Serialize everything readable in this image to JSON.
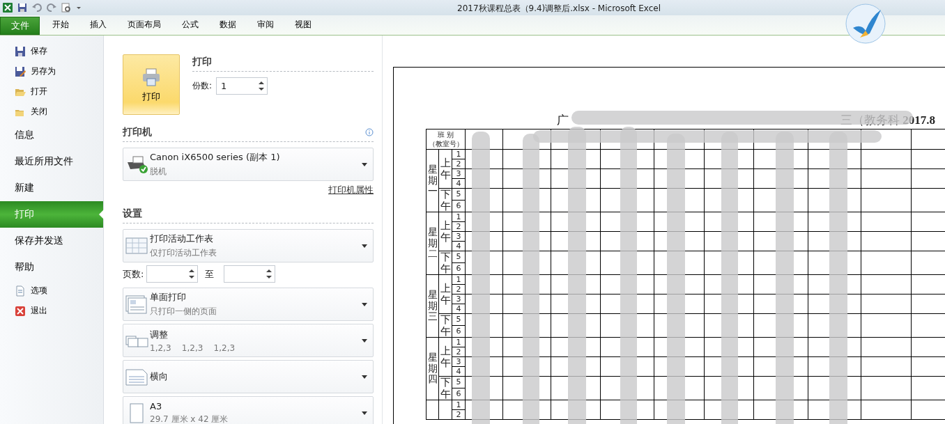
{
  "window": {
    "title": "2017秋课程总表（9.4)调整后.xlsx  -  Microsoft Excel"
  },
  "file_tab": "文件",
  "ribbon_tabs": [
    "开始",
    "插入",
    "页面布局",
    "公式",
    "数据",
    "审阅",
    "视图"
  ],
  "nav": [
    {
      "kind": "save",
      "label": "保存",
      "selected": false
    },
    {
      "kind": "saveas",
      "label": "另存为",
      "selected": false
    },
    {
      "kind": "open",
      "label": "打开",
      "selected": false
    },
    {
      "kind": "close",
      "label": "关闭",
      "selected": false
    },
    {
      "kind": "page",
      "label": "信息",
      "selected": false
    },
    {
      "kind": "page",
      "label": "最近所用文件",
      "selected": false
    },
    {
      "kind": "page",
      "label": "新建",
      "selected": false
    },
    {
      "kind": "page",
      "label": "打印",
      "selected": true
    },
    {
      "kind": "page",
      "label": "保存并发送",
      "selected": false
    },
    {
      "kind": "page",
      "label": "帮助",
      "selected": false
    },
    {
      "kind": "options",
      "label": "选项",
      "selected": false
    },
    {
      "kind": "exit",
      "label": "退出",
      "selected": false
    }
  ],
  "print": {
    "button": "打印",
    "heading": "打印",
    "copies_label": "份数:",
    "copies": "1"
  },
  "printer": {
    "heading": "打印机",
    "name": "Canon iX6500 series (副本 1)",
    "status": "脱机",
    "properties_link": "打印机属性"
  },
  "settings": {
    "heading": "设置",
    "pages_label": "页数:",
    "pages_to": "至",
    "options": [
      {
        "kind": "sheets",
        "title": "打印活动工作表",
        "subtitle": "仅打印活动工作表"
      },
      {
        "kind": "sides",
        "title": "单面打印",
        "subtitle": "只打印一侧的页面"
      },
      {
        "kind": "collate",
        "title": "调整",
        "subtitle": "1,2,3    1,2,3    1,2,3"
      },
      {
        "kind": "orientation",
        "title": "横向"
      },
      {
        "kind": "paper",
        "title": "A3",
        "subtitle": "29.7 厘米 x 42 厘米"
      }
    ]
  },
  "preview": {
    "title_start": "广",
    "title_end": "三（教务科  **2017.8**",
    "header_lines": [
      "班  别",
      "（教室号）"
    ],
    "days": [
      {
        "label": "星期一",
        "halves": [
          {
            "label": "上午",
            "periods": [
              "1",
              "2",
              "3",
              "4"
            ]
          },
          {
            "label": "下午",
            "periods": [
              "5",
              "6"
            ]
          }
        ]
      },
      {
        "label": "星期二",
        "halves": [
          {
            "label": "上午",
            "periods": [
              "1",
              "2",
              "3",
              "4"
            ]
          },
          {
            "label": "下午",
            "periods": [
              "5",
              "6"
            ]
          }
        ]
      },
      {
        "label": "星期三",
        "halves": [
          {
            "label": "上午",
            "periods": [
              "1",
              "2",
              "3",
              "4"
            ]
          },
          {
            "label": "下午",
            "periods": [
              "5",
              "6"
            ]
          }
        ]
      },
      {
        "label": "星期四",
        "halves": [
          {
            "label": "上午",
            "periods": [
              "1",
              "2",
              "3",
              "4"
            ]
          },
          {
            "label": "下午",
            "periods": [
              "5",
              "6"
            ]
          }
        ]
      },
      {
        "halves": [
          {
            "periods": [
              "1",
              "2"
            ]
          }
        ]
      }
    ]
  }
}
